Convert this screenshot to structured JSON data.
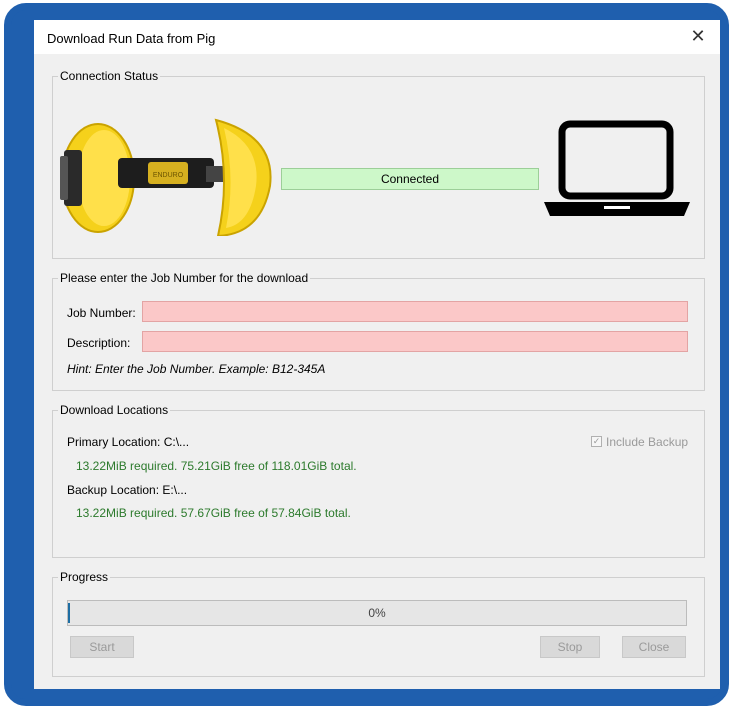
{
  "window": {
    "title": "Download Run Data from Pig",
    "close_glyph": "✕"
  },
  "connection": {
    "legend": "Connection Status",
    "status_text": "Connected",
    "status_color": "#cdf8c9",
    "pig_icon": "pipeline-pig-image",
    "laptop_icon": "laptop-icon"
  },
  "job": {
    "legend": "Please enter the Job Number for the download",
    "job_number_label": "Job Number:",
    "job_number_value": "",
    "description_label": "Description:",
    "description_value": "",
    "hint": "Hint:  Enter the Job Number. Example: B12-345A",
    "invalid_field_color": "#fbc8c8"
  },
  "locations": {
    "legend": "Download Locations",
    "primary_label": "Primary Location:  C:\\...",
    "primary_info": "13.22MiB required. 75.21GiB free of 118.01GiB total.",
    "backup_label": "Backup Location:  E:\\...",
    "backup_info": "13.22MiB required. 57.67GiB free of 57.84GiB total.",
    "include_backup_label": "Include Backup",
    "include_backup_checked": true,
    "info_color": "#2c7a2c"
  },
  "progress": {
    "legend": "Progress",
    "value_fraction": 0,
    "value_text": "0%",
    "start_label": "Start",
    "stop_label": "Stop",
    "close_label": "Close"
  },
  "frame_color": "#1f5fae"
}
